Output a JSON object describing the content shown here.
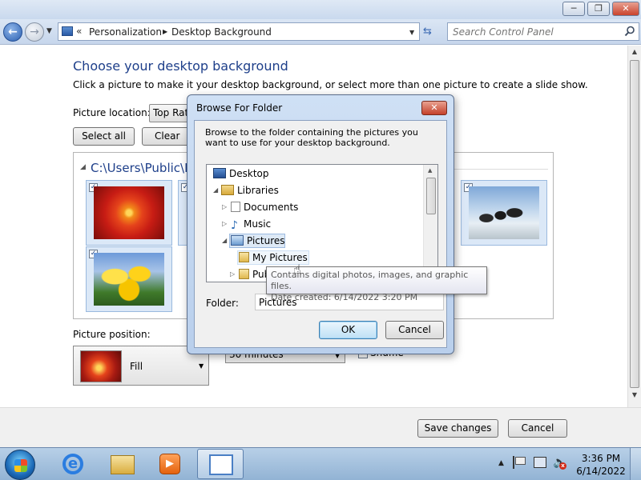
{
  "window": {
    "controls": {
      "minimize": "─",
      "maximize": "❐",
      "close": "✕"
    }
  },
  "navbar": {
    "back_glyph": "←",
    "forward_glyph": "→",
    "address_chevron": "«",
    "breadcrumb": [
      "Personalization",
      "Desktop Background"
    ],
    "refresh_glyph": "⇆",
    "search": {
      "placeholder": "Search Control Panel",
      "value": ""
    }
  },
  "content": {
    "heading": "Choose your desktop background",
    "subtext": "Click a picture to make it your desktop background, or select more than one picture to create a slide show.",
    "picture_location": {
      "label": "Picture location:",
      "value": "Top Rated Photos"
    },
    "select_all_label": "Select all",
    "clear_all_label": "Clear all",
    "group_header": "C:\\Users\\Public\\Pictures",
    "thumbnails": [
      {
        "name": "chrysanthemum",
        "checked": true
      },
      {
        "name": "tulips",
        "checked": true
      },
      {
        "name": "partially-hidden",
        "checked": true
      },
      {
        "name": "penguins",
        "checked": true
      }
    ],
    "check_glyph": "✓",
    "picture_position": {
      "label": "Picture position:",
      "value": "Fill"
    },
    "interval": {
      "value": "30 minutes"
    },
    "shuffle": {
      "label": "Shuffle",
      "checked": true
    },
    "save_changes_label": "Save changes",
    "cancel_label": "Cancel"
  },
  "dialog": {
    "title": "Browse For Folder",
    "close_glyph": "✕",
    "description": "Browse to the folder containing the pictures you want to use for your desktop background.",
    "tree": {
      "desktop": "Desktop",
      "libraries": "Libraries",
      "documents": "Documents",
      "music": "Music",
      "pictures": "Pictures",
      "my_pictures": "My Pictures",
      "public_pictures": "Public Pictures"
    },
    "folder_label": "Folder:",
    "folder_value": "Pictures",
    "ok_label": "OK",
    "cancel_label": "Cancel"
  },
  "tooltip": {
    "line1": "Contains digital photos, images, and graphic files.",
    "line2": "Date created: 6/14/2022 3:20 PM"
  },
  "taskbar": {
    "ie_glyph": "e",
    "media_glyph": "▶",
    "clock_time": "3:36 PM",
    "clock_date": "6/14/2022",
    "tray_arrow": "▲",
    "volume_glyph": "🔈",
    "volume_mute_glyph": "x"
  },
  "colors": {
    "heading": "#1e3f8a",
    "dialog_frame": "#b9cfec",
    "selection": "#dde9f6"
  }
}
